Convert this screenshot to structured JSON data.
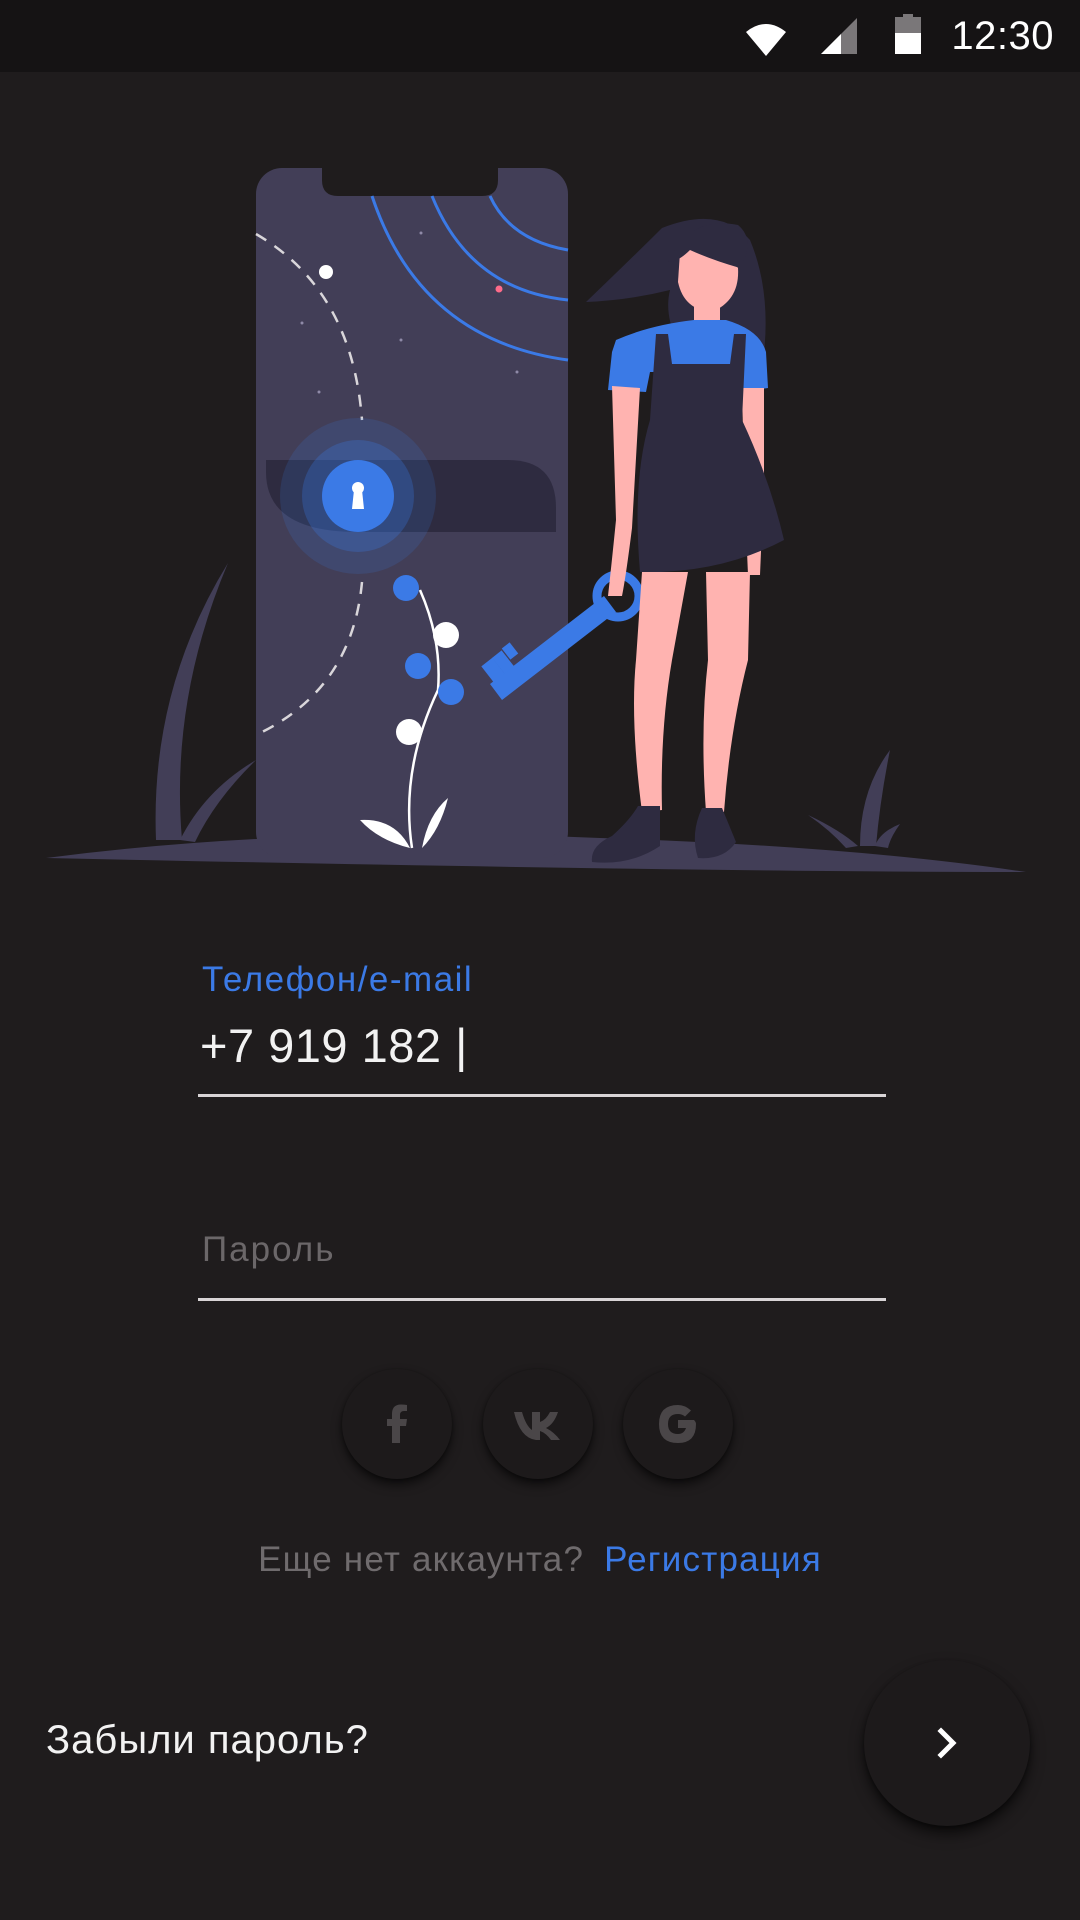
{
  "status_bar": {
    "time": "12:30",
    "icons": [
      "wifi-icon",
      "cell-signal-icon",
      "battery-icon"
    ]
  },
  "colors": {
    "accent": "#3b7ae6",
    "background": "#1f1c1d",
    "status_bar": "#151314",
    "illustration_dark": "#423e57",
    "skin": "#ffb3b0"
  },
  "illustration": {
    "description_icon": "phone-lock-key-illustration"
  },
  "form": {
    "login": {
      "label": "Телефон/e-mail",
      "value": "+7 919 182 |"
    },
    "password": {
      "placeholder": "Пароль"
    }
  },
  "social": {
    "buttons": [
      {
        "name": "facebook",
        "icon": "facebook-icon",
        "label": "f"
      },
      {
        "name": "vk",
        "icon": "vk-icon",
        "label": "vk"
      },
      {
        "name": "google",
        "icon": "google-icon",
        "label": "G"
      }
    ]
  },
  "register": {
    "question": "Еще нет аккаунта?",
    "link": "Регистрация"
  },
  "footer": {
    "forgot": "Забыли пароль?",
    "next_icon": "chevron-right-icon"
  }
}
